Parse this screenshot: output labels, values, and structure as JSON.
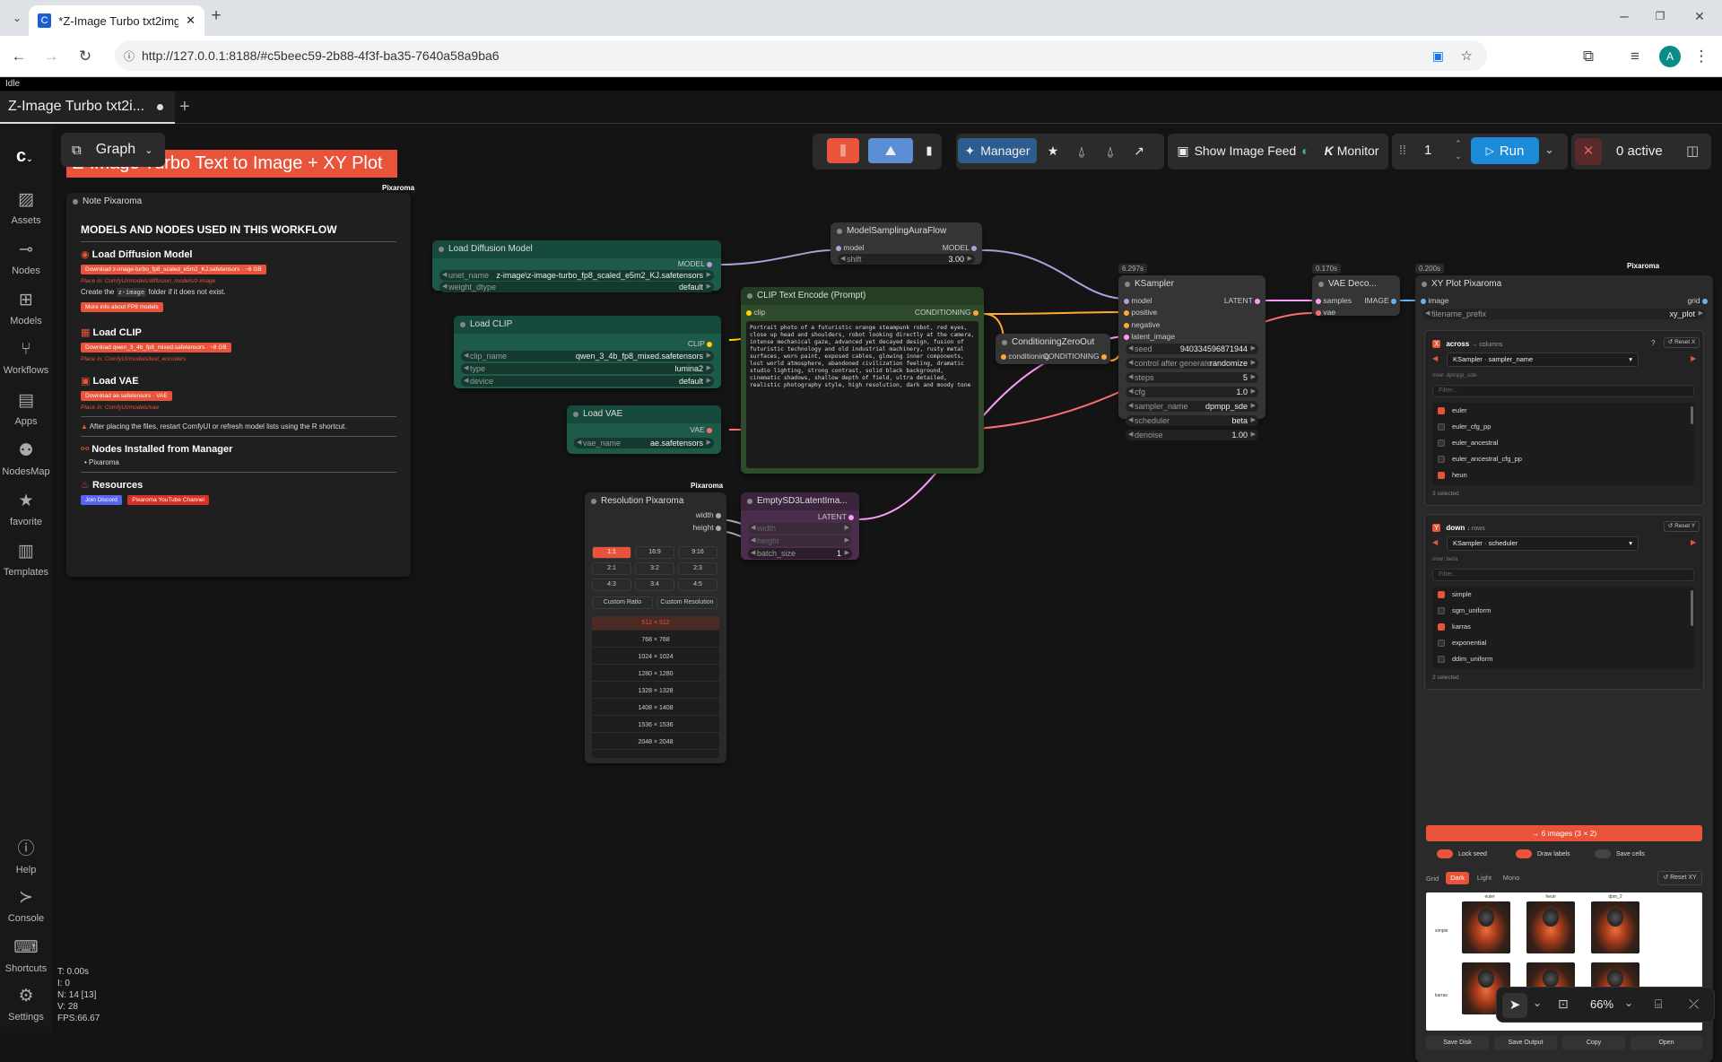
{
  "browser": {
    "tab_title": "*Z-Image Turbo txt2img + XY Pl",
    "url": "http://127.0.0.1:8188/#c5beec59-2b88-4f3f-ba35-7640a58a9ba6",
    "profile_initial": "A"
  },
  "app": {
    "status": "Idle",
    "workflow_tab": "Z-Image Turbo txt2i...",
    "graph_label": "Graph",
    "title_banner": "Z-Image Turbo Text to Image + XY Plot"
  },
  "sidebar": {
    "items": [
      {
        "label": "Assets",
        "icon": "assets-icon"
      },
      {
        "label": "Nodes",
        "icon": "nodes-icon"
      },
      {
        "label": "Models",
        "icon": "models-icon"
      },
      {
        "label": "Workflows",
        "icon": "workflows-icon"
      },
      {
        "label": "Apps",
        "icon": "apps-icon"
      },
      {
        "label": "NodesMap",
        "icon": "nodesmap-icon"
      },
      {
        "label": "favorite",
        "icon": "star-icon"
      },
      {
        "label": "Templates",
        "icon": "templates-icon"
      }
    ],
    "bottom": [
      {
        "label": "Help",
        "icon": "help-icon"
      },
      {
        "label": "Console",
        "icon": "console-icon"
      },
      {
        "label": "Shortcuts",
        "icon": "keyboard-icon"
      },
      {
        "label": "Settings",
        "icon": "gear-icon"
      }
    ]
  },
  "toolbar": {
    "manager": "Manager",
    "show_feed": "Show Image Feed",
    "monitor": "Monitor",
    "batch_count": "1",
    "run": "Run",
    "active": "0 active"
  },
  "stats": {
    "t": "T: 0.00s",
    "i": "I: 0",
    "n": "N: 14 [13]",
    "v": "V: 28",
    "fps": "FPS:66.67"
  },
  "zoom": "66%",
  "note": {
    "header": "Note Pixaroma",
    "brand": "Pixaroma",
    "heading": "MODELS AND NODES USED IN THIS WORKFLOW",
    "s1_title": "Load Diffusion Model",
    "s1_btn": "Download z-image-turbo_fp8_scaled_e5m2_KJ.safetensors · ~6 GB",
    "s1_place": "Place in: ComfyUI/models/diffusion_models/z-image",
    "s1_create_a": "Create the",
    "s1_create_code": "z-image",
    "s1_create_b": "folder if it does not exist.",
    "s1_more": "More info about FP8 models",
    "s2_title": "Load CLIP",
    "s2_btn": "Download qwen_3_4b_fp8_mixed.safetensors · ~8 GB",
    "s2_place": "Place in: ComfyUI/models/text_encoders",
    "s3_title": "Load VAE",
    "s3_btn": "Download ae.safetensors · VAE",
    "s3_place": "Place in: ComfyUI/models/vae",
    "warn": "After placing the files, restart ComfyUI or refresh model lists using the R shortcut.",
    "s4_title": "Nodes Installed from Manager",
    "s4_item": "Pixaroma",
    "s5_title": "Resources",
    "discord": "Join Discord",
    "youtube": "Pixaroma YouTube Channel"
  },
  "nodes": {
    "load_diffusion": {
      "title": "Load Diffusion Model",
      "out": "MODEL",
      "unet_label": "unet_name",
      "unet_value": "z-image\\z-image-turbo_fp8_scaled_e5m2_KJ.safetensors",
      "dtype_label": "weight_dtype",
      "dtype_value": "default"
    },
    "load_clip": {
      "title": "Load CLIP",
      "out": "CLIP",
      "name_label": "clip_name",
      "name_value": "qwen_3_4b_fp8_mixed.safetensors",
      "type_label": "type",
      "type_value": "lumina2",
      "device_label": "device",
      "device_value": "default"
    },
    "load_vae": {
      "title": "Load VAE",
      "out": "VAE",
      "name_label": "vae_name",
      "name_value": "ae.safetensors"
    },
    "msaf": {
      "title": "ModelSamplingAuraFlow",
      "in": "model",
      "out": "MODEL",
      "shift_label": "shift",
      "shift_value": "3.00"
    },
    "clip_text": {
      "title": "CLIP Text Encode (Prompt)",
      "in": "clip",
      "out": "CONDITIONING",
      "prompt": "Portrait photo of a futuristic orange steampunk robot, red eyes, close up head and shoulders, robot looking directly at the camera, intense mechanical gaze, advanced yet decayed design, fusion of futuristic technology and old industrial machinery, rusty metal surfaces, worn paint, exposed cables, glowing inner components, lost world atmosphere, abandoned civilization feeling, dramatic studio lighting, strong contrast, solid black background, cinematic shadows, shallow depth of field, ultra detailed, realistic photography style, high resolution, dark and moody tone"
    },
    "cond_zero": {
      "title": "ConditioningZeroOut",
      "in": "conditioning",
      "out": "CONDITIONING"
    },
    "ksampler": {
      "title": "KSampler",
      "badge": "6.297s",
      "in_model": "model",
      "in_pos": "positive",
      "in_neg": "negative",
      "in_latent": "latent_image",
      "out": "LATENT",
      "widgets": [
        {
          "label": "seed",
          "value": "940334596871944"
        },
        {
          "label": "control after generate",
          "value": "randomize"
        },
        {
          "label": "steps",
          "value": "5"
        },
        {
          "label": "cfg",
          "value": "1.0"
        },
        {
          "label": "sampler_name",
          "value": "dpmpp_sde"
        },
        {
          "label": "scheduler",
          "value": "beta"
        },
        {
          "label": "denoise",
          "value": "1.00"
        }
      ]
    },
    "vae_decode": {
      "title": "VAE Deco...",
      "badge": "0.170s",
      "in_samples": "samples",
      "in_vae": "vae",
      "out": "IMAGE"
    },
    "resolution": {
      "title": "Resolution Pixaroma",
      "brand": "Pixaroma",
      "out_w": "width",
      "out_h": "height",
      "ratios": [
        "1:1",
        "16:9",
        "9:16",
        "2:1",
        "3:2",
        "2:3",
        "4:3",
        "3:4",
        "4:5"
      ],
      "custom_ratio": "Custom Ratio",
      "custom_res": "Custom Resolution",
      "sizes": [
        "512 × 512",
        "768 × 768",
        "1024 × 1024",
        "1280 × 1280",
        "1328 × 1328",
        "1408 × 1408",
        "1536 × 1536",
        "2048 × 2048"
      ]
    },
    "empty_latent": {
      "title": "EmptySD3LatentIma...",
      "out": "LATENT",
      "w": "width",
      "h": "height",
      "batch_label": "batch_size",
      "batch_value": "1"
    },
    "xyplot": {
      "title": "XY Plot Pixaroma",
      "badge": "0.200s",
      "brand": "Pixaroma",
      "in_image": "image",
      "out_grid": "grid",
      "prefix_label": "filename_prefix",
      "prefix_value": "xy_plot",
      "across_label": "across",
      "across_sub": "→ columns",
      "across_select": "KSampler · sampler_name",
      "across_now": "now: dpmpp_sde",
      "reset_x": "Reset X",
      "filter": "Filter...",
      "x_items": [
        {
          "name": "euler",
          "on": true
        },
        {
          "name": "euler_cfg_pp",
          "on": false
        },
        {
          "name": "euler_ancestral",
          "on": false
        },
        {
          "name": "euler_ancestral_cfg_pp",
          "on": false
        },
        {
          "name": "heun",
          "on": true
        }
      ],
      "x_selected": "3 selected",
      "down_label": "down",
      "down_sub": "↓ rows",
      "down_select": "KSampler · scheduler",
      "down_now": "now: beta",
      "reset_y": "Reset Y",
      "y_items": [
        {
          "name": "simple",
          "on": true
        },
        {
          "name": "sgm_uniform",
          "on": false
        },
        {
          "name": "karras",
          "on": true
        },
        {
          "name": "exponential",
          "on": false
        },
        {
          "name": "ddim_uniform",
          "on": false
        }
      ],
      "y_selected": "2 selected",
      "images_btn": "→ 6 images (3 × 2)",
      "lock_seed": "Lock seed",
      "draw_labels": "Draw labels",
      "save_cells": "Save cells",
      "grid_label": "Grid",
      "dark": "Dark",
      "light": "Light",
      "mono": "Mono",
      "reset_xy": "Reset XY",
      "col_heads": [
        "euler",
        "heun",
        "dpm_2"
      ],
      "row_heads": [
        "simple",
        "karras"
      ],
      "save_disk": "Save Disk",
      "save_output": "Save Output",
      "copy": "Copy",
      "open": "Open"
    }
  }
}
